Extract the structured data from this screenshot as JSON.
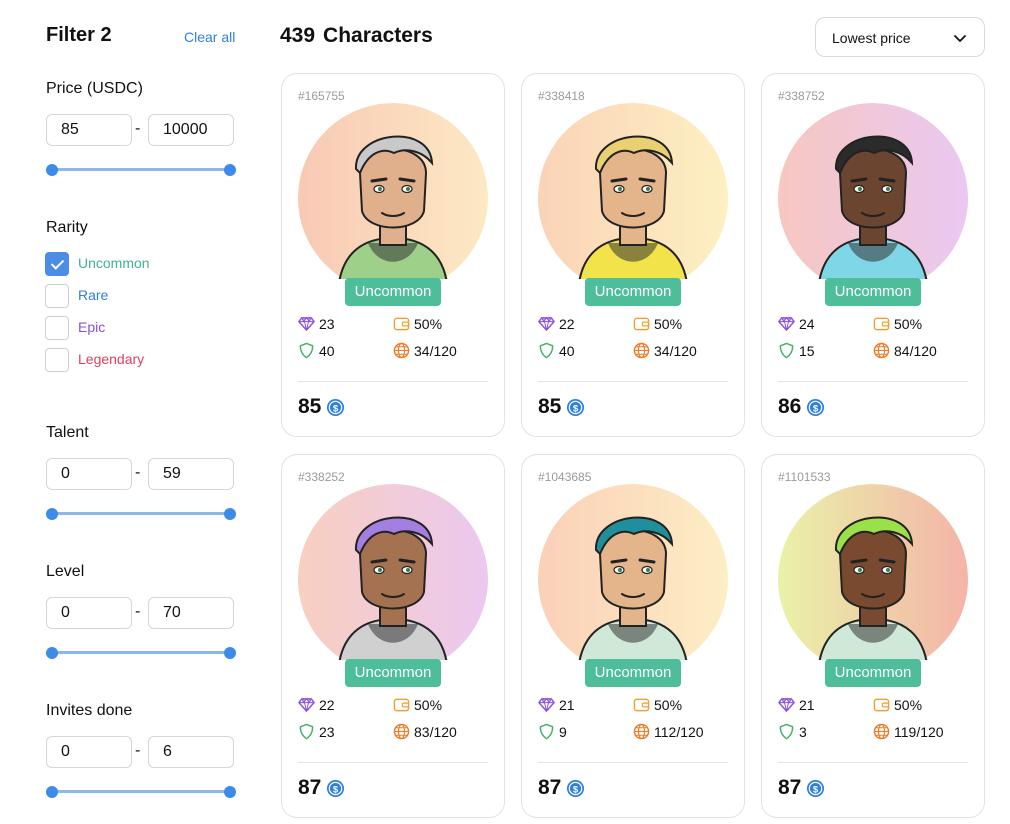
{
  "sidebar": {
    "title": "Filter 2",
    "clear_all": "Clear all",
    "price": {
      "label": "Price (USDC)",
      "min": "85",
      "max": "10000"
    },
    "rarity": {
      "label": "Rarity",
      "options": [
        {
          "label": "Uncommon",
          "checked": true,
          "color": "#3fb28d"
        },
        {
          "label": "Rare",
          "checked": false,
          "color": "#2f7fe0"
        },
        {
          "label": "Epic",
          "checked": false,
          "color": "#8a4fe0"
        },
        {
          "label": "Legendary",
          "checked": false,
          "color": "#e0415a"
        }
      ]
    },
    "talent": {
      "label": "Talent",
      "min": "0",
      "max": "59"
    },
    "level": {
      "label": "Level",
      "min": "0",
      "max": "70"
    },
    "invites": {
      "label": "Invites done",
      "min": "0",
      "max": "6"
    }
  },
  "main": {
    "count": "439",
    "title": "Characters",
    "sort": {
      "selected": "Lowest price"
    }
  },
  "cards": [
    {
      "id": "#165755",
      "rarity": "Uncommon",
      "gems": "23",
      "wallet": "50%",
      "shield": "40",
      "globe": "34/120",
      "price": "85",
      "hair": "#c9c9c9",
      "skin": "#e0b08c",
      "hoodie": "#9ed08a",
      "bg": [
        "#f8c9b4",
        "#fde9c4"
      ]
    },
    {
      "id": "#338418",
      "rarity": "Uncommon",
      "gems": "22",
      "wallet": "50%",
      "shield": "40",
      "globe": "34/120",
      "price": "85",
      "hair": "#e9d070",
      "skin": "#e4b48a",
      "hoodie": "#f2e34a",
      "bg": [
        "#fbd3b8",
        "#fdf0c2"
      ]
    },
    {
      "id": "#338752",
      "rarity": "Uncommon",
      "gems": "24",
      "wallet": "50%",
      "shield": "15",
      "globe": "84/120",
      "price": "86",
      "hair": "#2b2b2b",
      "skin": "#6b4530",
      "hoodie": "#7fd6e6",
      "bg": [
        "#f7c7c0",
        "#e9c8f2"
      ]
    },
    {
      "id": "#338252",
      "rarity": "Uncommon",
      "gems": "22",
      "wallet": "50%",
      "shield": "23",
      "globe": "83/120",
      "price": "87",
      "hair": "#a27fe0",
      "skin": "#a47250",
      "hoodie": "#d0d0d0",
      "bg": [
        "#f8cfc0",
        "#ebc8f0"
      ]
    },
    {
      "id": "#1043685",
      "rarity": "Uncommon",
      "gems": "21",
      "wallet": "50%",
      "shield": "9",
      "globe": "112/120",
      "price": "87",
      "hair": "#1f8f9c",
      "skin": "#e4b48a",
      "hoodie": "#cfe8d8",
      "bg": [
        "#fbd0b8",
        "#fdeec4"
      ]
    },
    {
      "id": "#1101533",
      "rarity": "Uncommon",
      "gems": "21",
      "wallet": "50%",
      "shield": "3",
      "globe": "119/120",
      "price": "87",
      "hair": "#9be04a",
      "skin": "#7a4a30",
      "hoodie": "#cfe8d8",
      "bg": [
        "#e9f2a8",
        "#f4b4a8"
      ]
    }
  ],
  "colors": {
    "accent": "#2f7fe0",
    "badge": "#4dbd9a",
    "gem": "#8a4fe0",
    "wallet": "#f0a030",
    "shield": "#3fb26a",
    "globe": "#f07a20",
    "coin": "#2f7fe0"
  },
  "icons": {
    "gems": "diamond-icon",
    "wallet": "wallet-icon",
    "shield": "shield-icon",
    "globe": "globe-icon",
    "price": "usdc-coin-icon",
    "sort": "chevron-down-icon"
  }
}
